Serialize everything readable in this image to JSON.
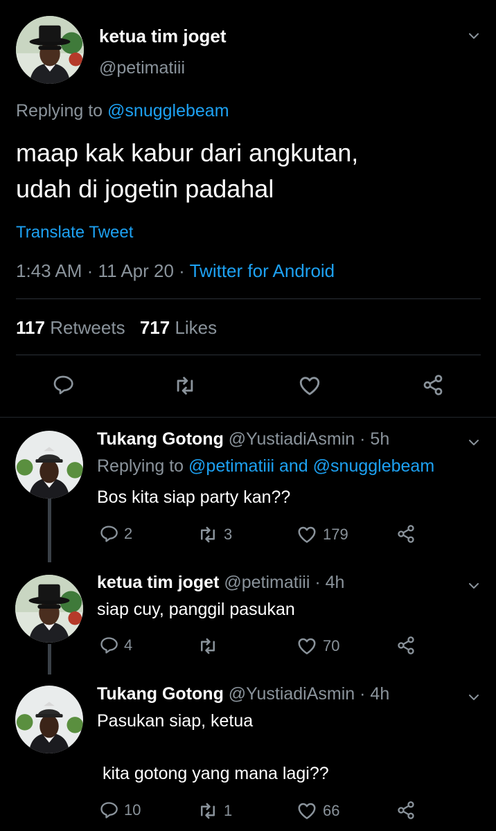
{
  "main_tweet": {
    "display_name": "ketua tim joget",
    "handle": "@petimatiii",
    "replying_prefix": "Replying to",
    "replying_to": "@snugglebeam",
    "text_line1": "maap kak kabur dari angkutan,",
    "text_line2": "udah di jogetin padahal",
    "translate": "Translate Tweet",
    "time": "1:43 AM",
    "sep": "·",
    "date": "11 Apr 20",
    "source": "Twitter for Android",
    "retweets_count": "117",
    "retweets_label": "Retweets",
    "likes_count": "717",
    "likes_label": "Likes"
  },
  "replies": [
    {
      "display_name": "Tukang Gotong",
      "handle": "@YustiadiAsmin",
      "age": "· 5h",
      "replying_prefix": "Replying to",
      "replying_to": "@petimatiii and @snugglebeam",
      "text": "Bos kita siap party kan??",
      "replies": "2",
      "retweets": "3",
      "likes": "179"
    },
    {
      "display_name": "ketua tim joget",
      "handle": "@petimatiii",
      "age": "· 4h",
      "text": "siap cuy, panggil pasukan",
      "replies": "4",
      "retweets": "",
      "likes": "70"
    },
    {
      "display_name": "Tukang Gotong",
      "handle": "@YustiadiAsmin",
      "age": "· 4h",
      "text_line1": "Pasukan siap, ketua",
      "text_line2": "kita gotong yang mana lagi??",
      "replies": "10",
      "retweets": "1",
      "likes": "66"
    }
  ],
  "colors": {
    "background": "#000000",
    "link": "#1da1f2",
    "muted": "#8a939b"
  }
}
